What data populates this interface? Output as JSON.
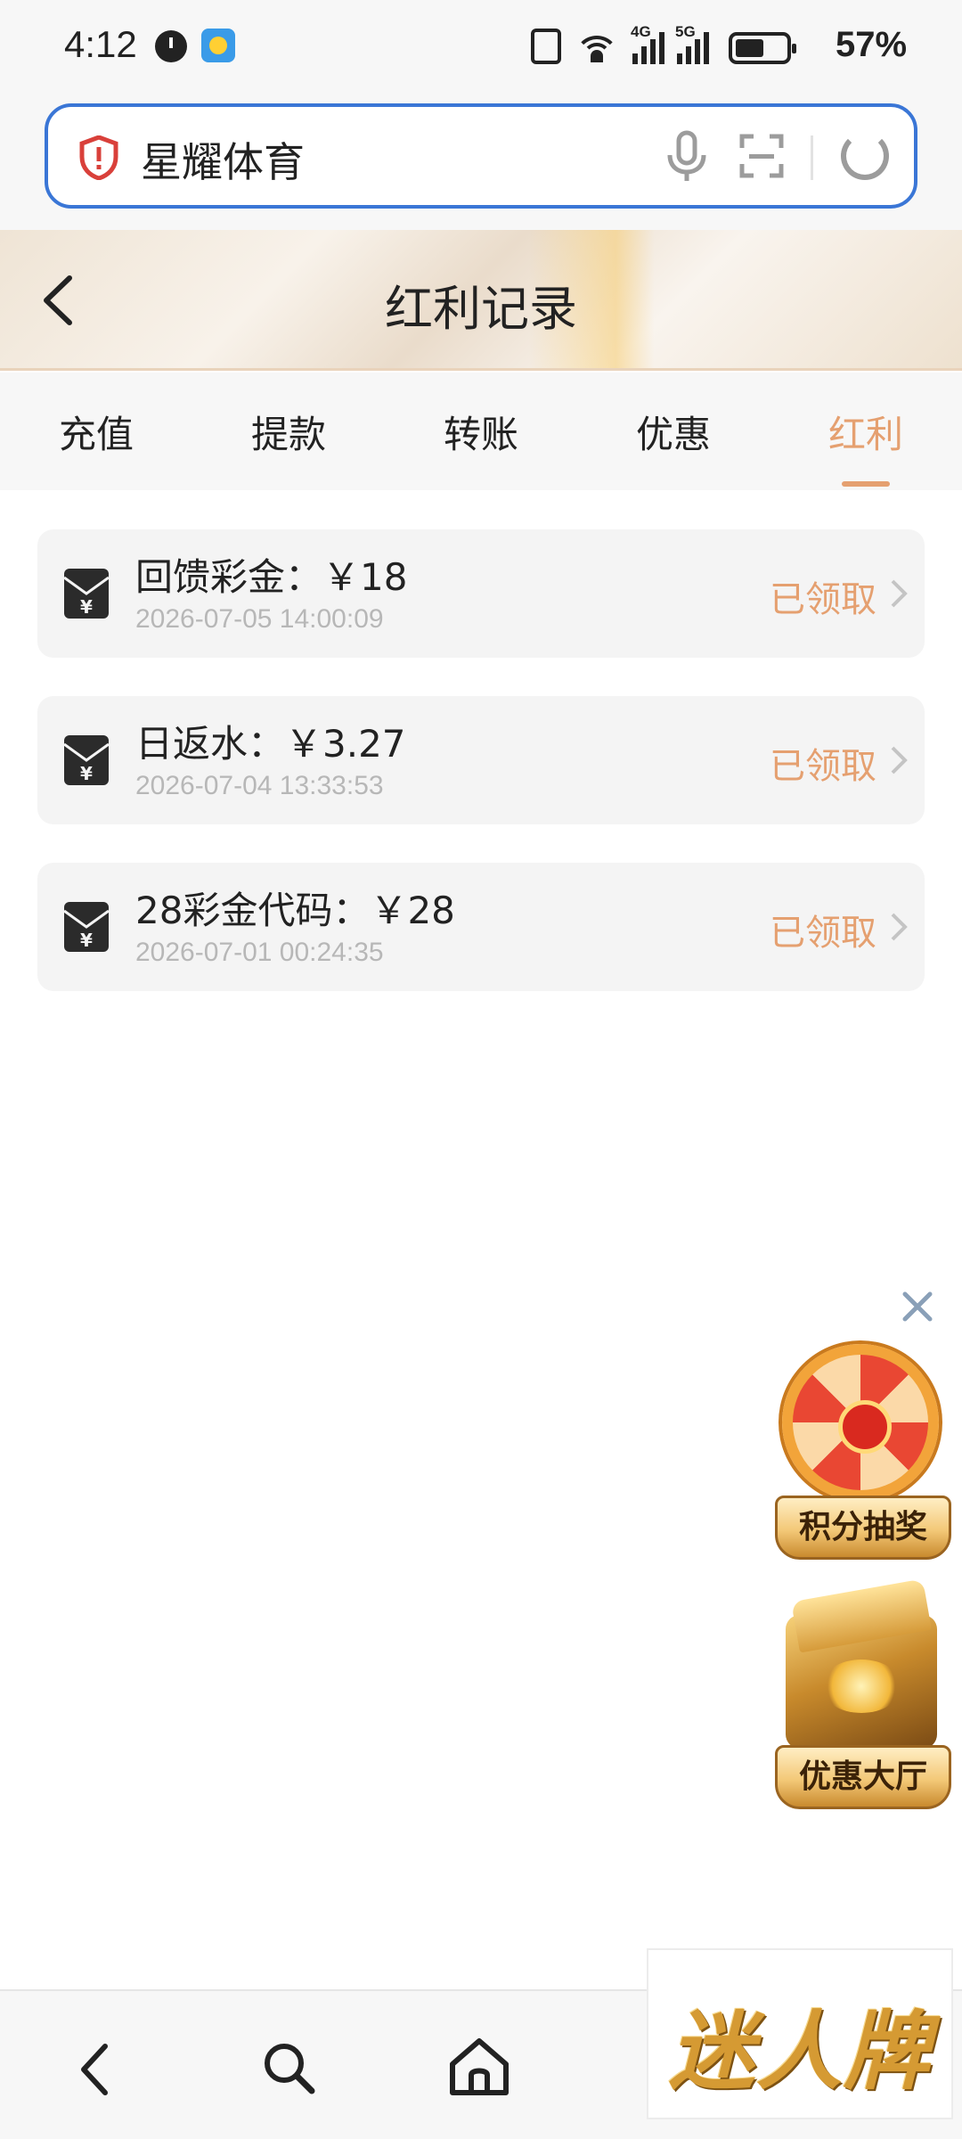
{
  "status_bar": {
    "time": "4:12",
    "battery_percent": "57%",
    "battery_level": 0.57,
    "signal_1_label": "4G",
    "signal_2_label": "5G",
    "wifi_label": "6"
  },
  "browser": {
    "url_text": "星耀体育",
    "icons": [
      "security-shield-icon",
      "mic-icon",
      "scan-icon",
      "refresh-icon"
    ]
  },
  "header": {
    "title": "红利记录",
    "back_icon": "chevron-left-icon"
  },
  "tabs": [
    {
      "label": "充值",
      "active": false
    },
    {
      "label": "提款",
      "active": false
    },
    {
      "label": "转账",
      "active": false
    },
    {
      "label": "优惠",
      "active": false
    },
    {
      "label": "红利",
      "active": true
    }
  ],
  "records": [
    {
      "title": "回馈彩金：￥18",
      "time": "2026-07-05 14:00:09",
      "status": "已领取"
    },
    {
      "title": "日返水：￥3.27",
      "time": "2026-07-04 13:33:53",
      "status": "已领取"
    },
    {
      "title": "28彩金代码：￥28",
      "time": "2026-07-01 00:24:35",
      "status": "已领取"
    }
  ],
  "floating": {
    "lottery_label": "积分抽奖",
    "offer_label": "优惠大厅",
    "close_icon": "close-icon"
  },
  "bottom_nav": {
    "icons": [
      "back-icon",
      "search-icon",
      "home-icon"
    ],
    "watermark_text": "迷人牌"
  },
  "colors": {
    "accent": "#e5a070",
    "url_border": "#3a76d6",
    "shield_red": "#d9403a"
  }
}
